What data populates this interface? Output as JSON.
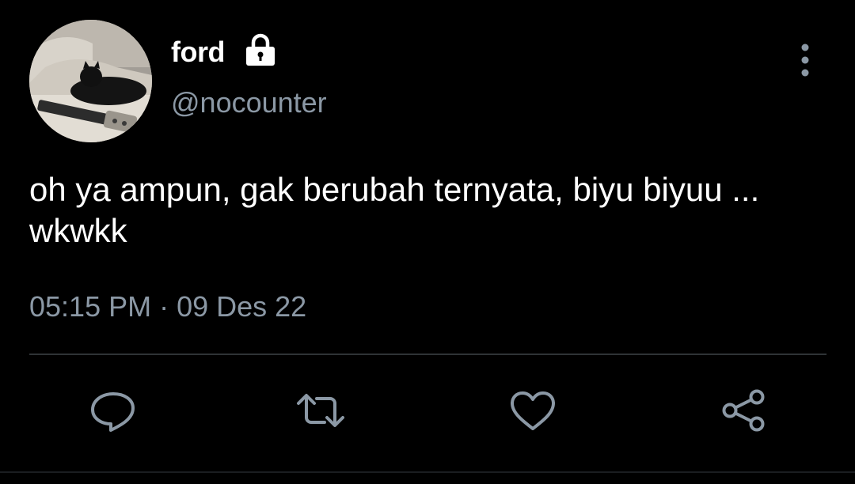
{
  "tweet": {
    "author": {
      "display_name": "ford",
      "handle": "@nocounter",
      "protected_icon": "lock-icon"
    },
    "text": "oh ya ampun, gak berubah ternyata, biyu biyuu ... wkwkk",
    "timestamp": "05:15 PM · 09 Des 22",
    "menu_icon": "more-vertical-icon",
    "actions": [
      {
        "icon": "reply-icon"
      },
      {
        "icon": "retweet-icon"
      },
      {
        "icon": "like-icon"
      },
      {
        "icon": "share-icon"
      }
    ]
  },
  "colors": {
    "background": "#000000",
    "text_primary": "#ffffff",
    "text_secondary": "#8b98a5",
    "divider": "#2f3336",
    "icon": "#8b98a5"
  }
}
